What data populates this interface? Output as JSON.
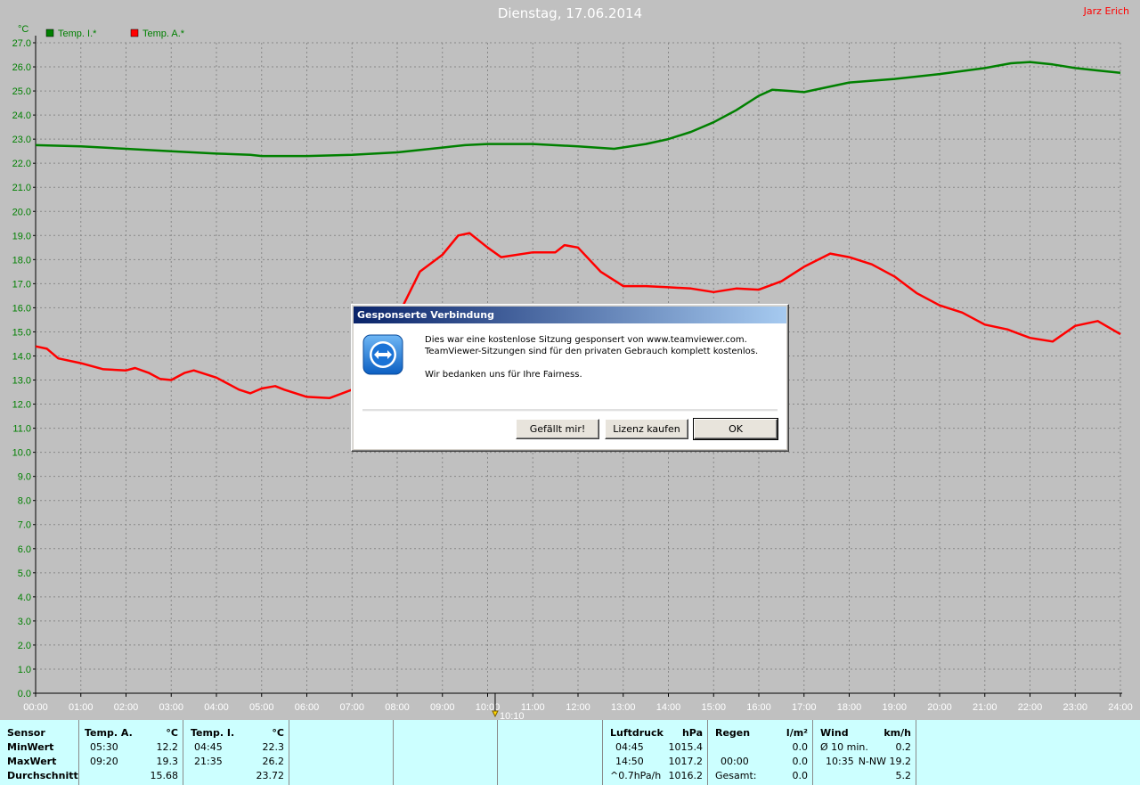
{
  "header": {
    "title": "Dienstag, 17.06.2014",
    "author": "Jarz Erich",
    "unit": "°C"
  },
  "legend": [
    {
      "label": "Temp. I.*",
      "color": "#008000",
      "text_color": "#008000"
    },
    {
      "label": "Temp. A.*",
      "color": "#ff0000",
      "text_color": "#008000"
    }
  ],
  "cursor_label": "10:10",
  "chart_data": {
    "type": "line",
    "title": "Dienstag, 17.06.2014",
    "xlabel": "",
    "ylabel": "°C",
    "x_ticks": [
      "00:00",
      "01:00",
      "02:00",
      "03:00",
      "04:00",
      "05:00",
      "06:00",
      "07:00",
      "08:00",
      "09:00",
      "10:00",
      "11:00",
      "12:00",
      "13:00",
      "14:00",
      "15:00",
      "16:00",
      "17:00",
      "18:00",
      "19:00",
      "20:00",
      "21:00",
      "22:00",
      "23:00",
      "24:00"
    ],
    "y_ticks": [
      "0.0",
      "1.0",
      "2.0",
      "3.0",
      "4.0",
      "5.0",
      "6.0",
      "7.0",
      "8.0",
      "9.0",
      "10.0",
      "11.0",
      "12.0",
      "13.0",
      "14.0",
      "15.0",
      "16.0",
      "17.0",
      "18.0",
      "19.0",
      "20.0",
      "21.0",
      "22.0",
      "23.0",
      "24.0",
      "25.0",
      "26.0",
      "27.0"
    ],
    "xlim": [
      0,
      24
    ],
    "ylim": [
      0,
      27
    ],
    "grid": true,
    "legend_position": "top-left",
    "series": [
      {
        "name": "Temp. I.*",
        "color": "#008000",
        "points": [
          [
            0,
            22.75
          ],
          [
            1,
            22.7
          ],
          [
            2,
            22.6
          ],
          [
            3,
            22.5
          ],
          [
            4,
            22.4
          ],
          [
            4.75,
            22.35
          ],
          [
            5,
            22.3
          ],
          [
            6,
            22.3
          ],
          [
            7,
            22.35
          ],
          [
            8,
            22.45
          ],
          [
            9,
            22.65
          ],
          [
            9.5,
            22.75
          ],
          [
            10,
            22.8
          ],
          [
            11,
            22.8
          ],
          [
            12,
            22.7
          ],
          [
            12.8,
            22.6
          ],
          [
            13.5,
            22.8
          ],
          [
            14,
            23.0
          ],
          [
            14.5,
            23.3
          ],
          [
            15,
            23.7
          ],
          [
            15.5,
            24.2
          ],
          [
            16,
            24.8
          ],
          [
            16.3,
            25.05
          ],
          [
            16.7,
            25.0
          ],
          [
            17,
            24.95
          ],
          [
            17.5,
            25.15
          ],
          [
            18,
            25.35
          ],
          [
            19,
            25.5
          ],
          [
            20,
            25.7
          ],
          [
            21,
            25.95
          ],
          [
            21.58,
            26.15
          ],
          [
            22,
            26.2
          ],
          [
            22.5,
            26.1
          ],
          [
            23,
            25.95
          ],
          [
            23.5,
            25.85
          ],
          [
            24,
            25.75
          ]
        ]
      },
      {
        "name": "Temp. A.*",
        "color": "#ff0000",
        "points": [
          [
            0,
            14.4
          ],
          [
            0.25,
            14.3
          ],
          [
            0.5,
            13.9
          ],
          [
            1,
            13.7
          ],
          [
            1.5,
            13.45
          ],
          [
            2,
            13.4
          ],
          [
            2.2,
            13.5
          ],
          [
            2.5,
            13.3
          ],
          [
            2.75,
            13.05
          ],
          [
            3,
            13.0
          ],
          [
            3.3,
            13.3
          ],
          [
            3.5,
            13.4
          ],
          [
            4,
            13.1
          ],
          [
            4.5,
            12.6
          ],
          [
            4.75,
            12.45
          ],
          [
            5,
            12.65
          ],
          [
            5.3,
            12.75
          ],
          [
            5.5,
            12.6
          ],
          [
            6,
            12.3
          ],
          [
            6.5,
            12.25
          ],
          [
            7,
            12.6
          ],
          [
            7.5,
            13.3
          ],
          [
            8,
            15.6
          ],
          [
            8.5,
            17.5
          ],
          [
            9,
            18.2
          ],
          [
            9.35,
            19.0
          ],
          [
            9.6,
            19.1
          ],
          [
            10,
            18.5
          ],
          [
            10.3,
            18.1
          ],
          [
            11,
            18.3
          ],
          [
            11.5,
            18.3
          ],
          [
            11.7,
            18.6
          ],
          [
            12,
            18.5
          ],
          [
            12.5,
            17.5
          ],
          [
            13,
            16.9
          ],
          [
            13.5,
            16.9
          ],
          [
            14,
            16.85
          ],
          [
            14.5,
            16.8
          ],
          [
            15,
            16.65
          ],
          [
            15.5,
            16.8
          ],
          [
            16,
            16.75
          ],
          [
            16.5,
            17.1
          ],
          [
            17,
            17.7
          ],
          [
            17.58,
            18.25
          ],
          [
            18,
            18.1
          ],
          [
            18.5,
            17.8
          ],
          [
            19,
            17.3
          ],
          [
            19.5,
            16.6
          ],
          [
            20,
            16.1
          ],
          [
            20.5,
            15.8
          ],
          [
            21,
            15.3
          ],
          [
            21.5,
            15.1
          ],
          [
            22,
            14.75
          ],
          [
            22.5,
            14.6
          ],
          [
            23,
            15.25
          ],
          [
            23.5,
            15.45
          ],
          [
            24,
            14.9
          ]
        ]
      }
    ]
  },
  "dialog": {
    "title": "Gesponserte Verbindung",
    "icon": "teamviewer-icon",
    "line1": "Dies war eine kostenlose Sitzung gesponsert von www.teamviewer.com.",
    "line2": "TeamViewer-Sitzungen sind für den privaten Gebrauch komplett kostenlos.",
    "line3": "Wir bedanken uns für Ihre Fairness.",
    "buttons": {
      "like": "Gefällt mir!",
      "buy": "Lizenz kaufen",
      "ok": "OK"
    }
  },
  "footer": {
    "labels": {
      "header": "Sensor",
      "min": "MinWert",
      "max": "MaxWert",
      "avg": "Durchschnitt"
    },
    "temp_a": {
      "title": "Temp. A.",
      "unit": "°C",
      "min_time": "05:30",
      "min_val": "12.2",
      "max_time": "09:20",
      "max_val": "19.3",
      "avg": "15.68"
    },
    "temp_i": {
      "title": "Temp. I.",
      "unit": "°C",
      "min_time": "04:45",
      "min_val": "22.3",
      "max_time": "21:35",
      "max_val": "26.2",
      "avg": "23.72"
    },
    "pressure": {
      "title": "Luftdruck",
      "unit": "hPa",
      "min_time": "04:45",
      "min_val": "1015.4",
      "max_time": "14:50",
      "max_val": "1017.2",
      "trend_label": "^0.7hPa/h",
      "trend_val": "1016.2"
    },
    "rain": {
      "title": "Regen",
      "unit": "l/m²",
      "time": "00:00",
      "val": "0.0",
      "total_label": "Gesamt:",
      "total_val": "0.0",
      "val_min": "0.0"
    },
    "wind": {
      "title": "Wind",
      "unit": "km/h",
      "avg_label": "Ø 10 min.",
      "avg_val": "0.2",
      "max_time": "10:35",
      "max_dir_val": "N-NW 19.2",
      "avg_day": "5.2"
    }
  }
}
